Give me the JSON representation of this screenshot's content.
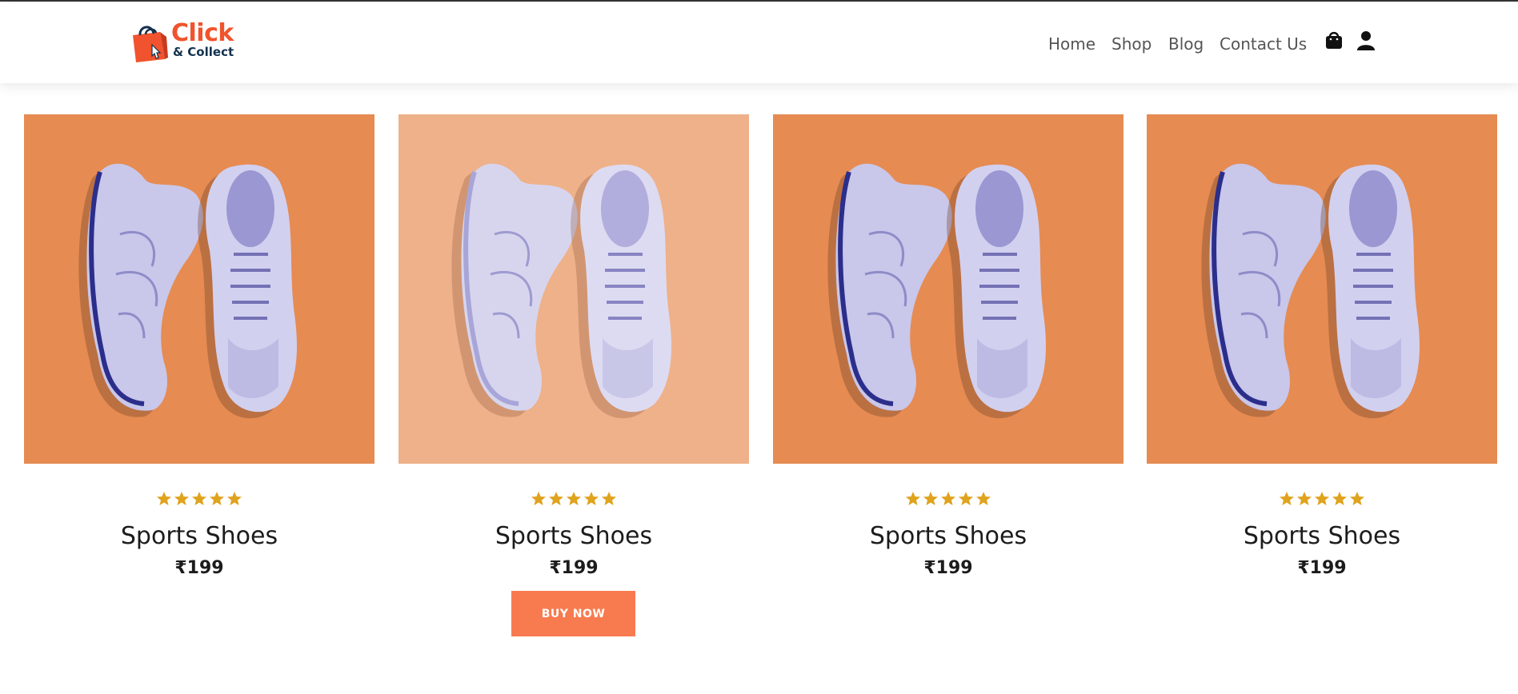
{
  "brand": {
    "name_line1": "Click",
    "name_line2": "& Collect",
    "primary_color": "#f0532d",
    "secondary_color": "#14324f"
  },
  "nav": {
    "links": [
      {
        "label": "Home"
      },
      {
        "label": "Shop"
      },
      {
        "label": "Blog"
      },
      {
        "label": "Contact Us"
      }
    ],
    "icons": [
      "shopping-bag-icon",
      "user-icon"
    ]
  },
  "products": [
    {
      "title": "Sports Shoes",
      "price": "₹199",
      "rating": 5,
      "image": "lavender-running-shoes-on-orange",
      "bg": "#e68b52"
    },
    {
      "title": "Sports Shoes",
      "price": "₹199",
      "rating": 5,
      "image": "lavender-running-shoes-on-peach",
      "bg": "#efb189",
      "button": "BUY NOW"
    },
    {
      "title": "Sports Shoes",
      "price": "₹199",
      "rating": 5,
      "image": "lavender-running-shoes-on-orange",
      "bg": "#e68b52"
    },
    {
      "title": "Sports Shoes",
      "price": "₹199",
      "rating": 5,
      "image": "lavender-running-shoes-on-orange",
      "bg": "#e68b52"
    }
  ],
  "colors": {
    "star": "#e0a31d",
    "button_bg": "#f77b4f",
    "text": "#1c1c1c",
    "nav_text": "#555555"
  }
}
